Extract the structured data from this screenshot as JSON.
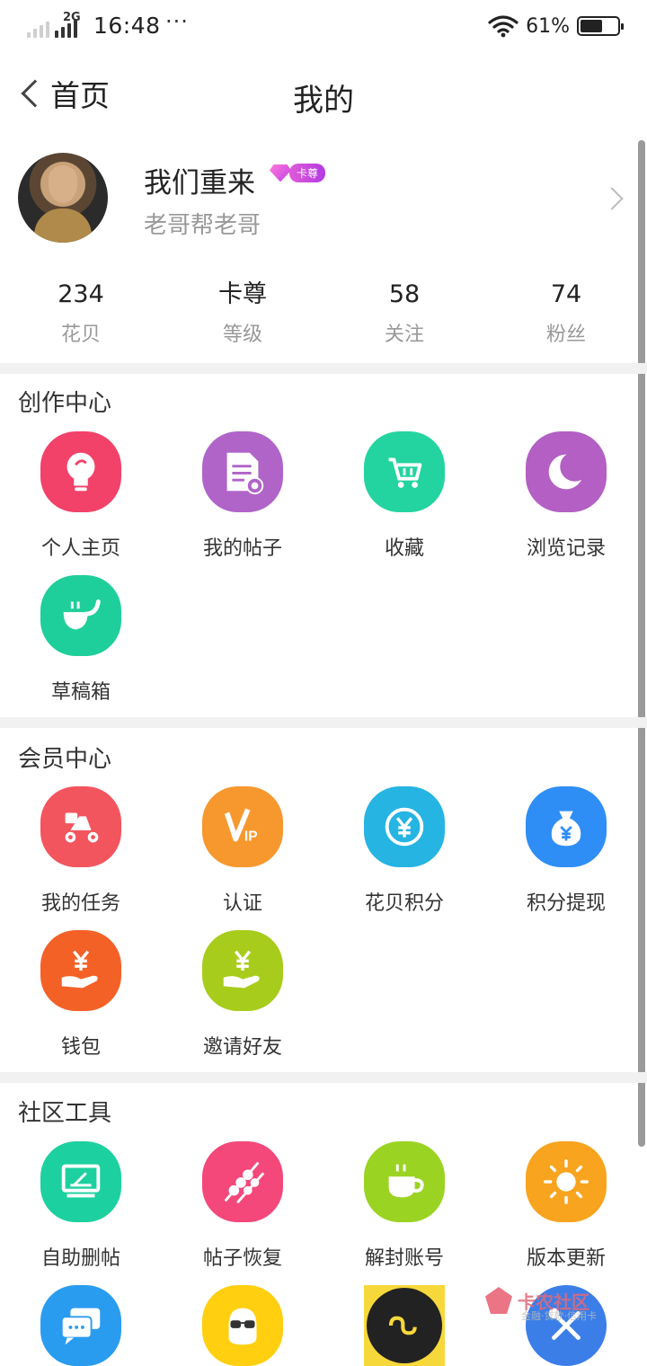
{
  "status_bar": {
    "network": "2G",
    "time": "16:48",
    "more": "···",
    "battery": "61%"
  },
  "nav": {
    "back_label": "首页",
    "title": "我的"
  },
  "profile": {
    "username": "我们重来",
    "badge": "卡尊",
    "signature": "老哥帮老哥"
  },
  "stats": [
    {
      "value": "234",
      "label": "花贝"
    },
    {
      "value": "卡尊",
      "label": "等级"
    },
    {
      "value": "58",
      "label": "关注"
    },
    {
      "value": "74",
      "label": "粉丝"
    }
  ],
  "creation": {
    "title": "创作中心",
    "items": [
      {
        "label": "个人主页",
        "icon": "lightbulb-icon",
        "color": "#f2426a"
      },
      {
        "label": "我的帖子",
        "icon": "document-icon",
        "color": "#b064c8"
      },
      {
        "label": "收藏",
        "icon": "cart-icon",
        "color": "#23d4a0"
      },
      {
        "label": "浏览记录",
        "icon": "moon-icon",
        "color": "#b35fc4"
      },
      {
        "label": "草稿箱",
        "icon": "pipe-icon",
        "color": "#1fcf9b"
      }
    ]
  },
  "member": {
    "title": "会员中心",
    "items": [
      {
        "label": "我的任务",
        "icon": "scooter-icon",
        "color": "#f2555e"
      },
      {
        "label": "认证",
        "icon": "vip-icon",
        "color": "#f7982f"
      },
      {
        "label": "花贝积分",
        "icon": "yen-cycle-icon",
        "color": "#26b4e3"
      },
      {
        "label": "积分提现",
        "icon": "money-bag-icon",
        "color": "#2f8ef5"
      },
      {
        "label": "钱包",
        "icon": "yen-hand-icon",
        "color": "#f46127"
      },
      {
        "label": "邀请好友",
        "icon": "yen-hand-icon",
        "color": "#a8cc1c"
      }
    ]
  },
  "tools": {
    "title": "社区工具",
    "items": [
      {
        "label": "自助删帖",
        "icon": "monitor-icon",
        "color": "#1dd0a0"
      },
      {
        "label": "帖子恢复",
        "icon": "skewer-icon",
        "color": "#f4477a"
      },
      {
        "label": "解封账号",
        "icon": "coffee-cup-icon",
        "color": "#9bd323"
      },
      {
        "label": "版本更新",
        "icon": "sun-icon",
        "color": "#f8a41e"
      },
      {
        "label": "",
        "icon": "chat-icon",
        "color": "#2a9cf0"
      },
      {
        "label": "",
        "icon": "sunglasses-face-icon",
        "color": "#ffcf10"
      },
      {
        "label": "",
        "icon": "mini-program-icon",
        "color": "#222222"
      },
      {
        "label": "",
        "icon": "tools-icon",
        "color": "#3b7ee8"
      }
    ]
  },
  "watermark": {
    "text": "卡农社区",
    "sub": "金融·贷款·信用卡"
  }
}
